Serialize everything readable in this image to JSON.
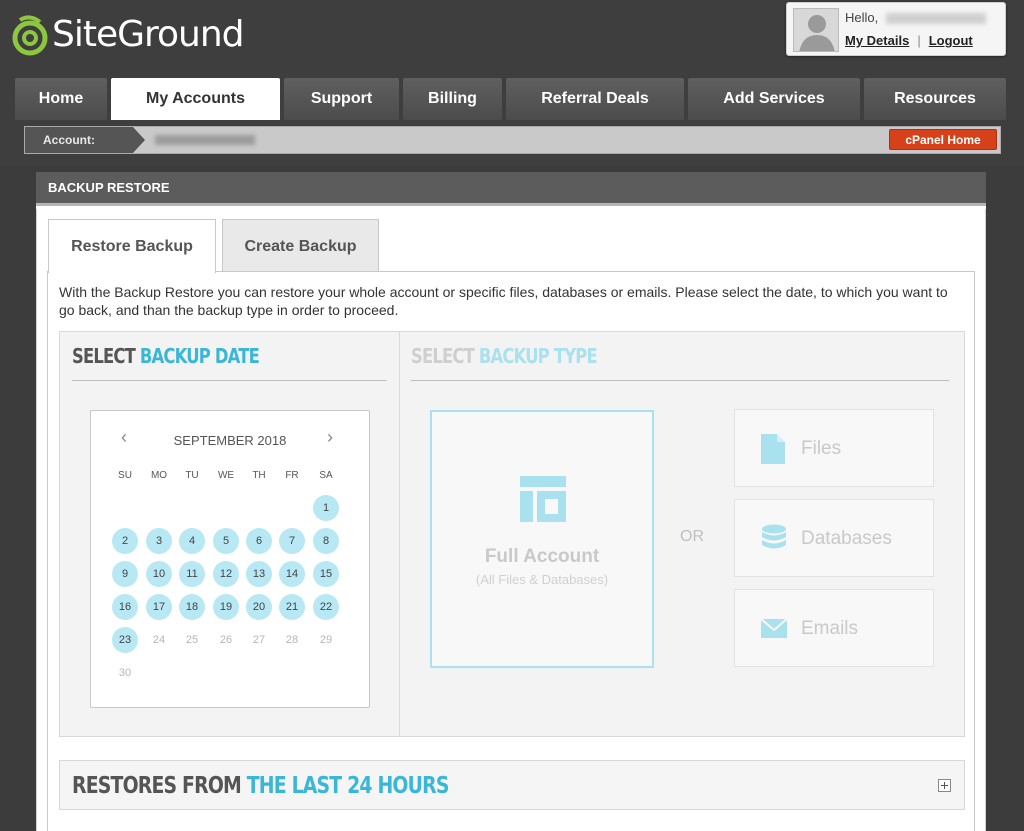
{
  "brand": {
    "name": "SiteGround",
    "accent": "#3ab7d7",
    "logo_green": "#8dc63f"
  },
  "user": {
    "greeting": "Hello,",
    "my_details": "My Details",
    "separator": "|",
    "logout": "Logout"
  },
  "nav": {
    "tabs": [
      {
        "label": "Home"
      },
      {
        "label": "My Accounts"
      },
      {
        "label": "Support"
      },
      {
        "label": "Billing"
      },
      {
        "label": "Referral Deals"
      },
      {
        "label": "Add Services"
      },
      {
        "label": "Resources"
      }
    ],
    "active": "My Accounts"
  },
  "account_bar": {
    "label": "Account:",
    "cpanel_button": "cPanel Home"
  },
  "panel": {
    "title": "BACKUP RESTORE",
    "tabs": [
      {
        "label": "Restore Backup"
      },
      {
        "label": "Create Backup"
      }
    ],
    "active_tab": "Restore Backup",
    "intro": "With the Backup Restore you can restore your whole account or specific files, databases or emails. Please select the date, to which you want to go back, and than the backup type in order to proceed."
  },
  "date_section": {
    "title_dark": "SELECT",
    "title_blue": "BACKUP DATE",
    "calendar": {
      "prev_icon": "chevron-left-icon",
      "next_icon": "chevron-right-icon",
      "prev_glyph": "‹",
      "next_glyph": "›",
      "month": "SEPTEMBER 2018",
      "weekdays": [
        "SU",
        "MO",
        "TU",
        "WE",
        "TH",
        "FR",
        "SA"
      ],
      "first_weekday": 6,
      "days_in_month": 30,
      "available_through": 23
    }
  },
  "type_section": {
    "title_dark": "SELECT",
    "title_blue": "BACKUP TYPE",
    "full_account": {
      "label": "Full Account",
      "sublabel": "(All Files & Databases)"
    },
    "or_label": "OR",
    "options": [
      {
        "label": "Files",
        "icon": "file-icon"
      },
      {
        "label": "Databases",
        "icon": "database-icon"
      },
      {
        "label": "Emails",
        "icon": "envelope-icon"
      }
    ]
  },
  "restores": {
    "title_dark": "RESTORES FROM",
    "title_blue": "THE LAST 24 HOURS",
    "toggle_icon": "expand-plus-icon"
  }
}
